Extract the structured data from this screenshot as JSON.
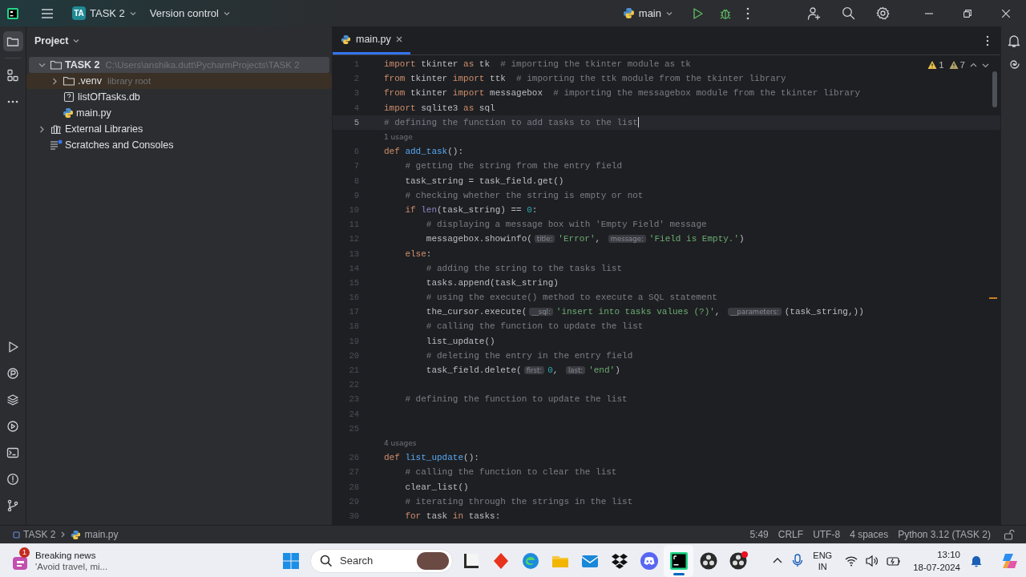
{
  "title_bar": {
    "project_badge": "TA",
    "project": "TASK 2",
    "vcs": "Version control",
    "run_config": "main"
  },
  "project_panel": {
    "title": "Project",
    "tree": [
      {
        "label": "TASK 2",
        "kind": "folder",
        "path": "C:\\Users\\anshika.dutt\\PycharmProjects\\TASK 2",
        "expanded": true,
        "selected": true,
        "library_root": false,
        "children": [
          {
            "label": ".venv",
            "kind": "folder",
            "hint": "library root",
            "expanded": false,
            "selected": false,
            "library_root": true
          },
          {
            "label": "listOfTasks.db",
            "kind": "unknown-file",
            "selected": false,
            "library_root": false
          },
          {
            "label": "main.py",
            "kind": "python",
            "selected": false,
            "library_root": false
          }
        ]
      },
      {
        "label": "External Libraries",
        "kind": "libraries",
        "expanded": false,
        "selected": false,
        "library_root": false
      },
      {
        "label": "Scratches and Consoles",
        "kind": "scratches",
        "selected": false,
        "library_root": false
      }
    ]
  },
  "editor": {
    "tab": {
      "label": "main.py",
      "selected": true
    },
    "inspections": [
      {
        "kind": "error",
        "count": "1"
      },
      {
        "kind": "warning",
        "count": "7"
      }
    ],
    "lines": [
      {
        "kind": "code",
        "number": "1",
        "current": false,
        "tokens": [
          {
            "kind": "kw",
            "text": "import"
          },
          {
            "kind": "pl",
            "text": " tkinter "
          },
          {
            "kind": "kw",
            "text": "as"
          },
          {
            "kind": "pl",
            "text": " tk  "
          },
          {
            "kind": "cm",
            "text": "# importing the tkinter module as tk"
          }
        ]
      },
      {
        "kind": "code",
        "number": "2",
        "current": false,
        "tokens": [
          {
            "kind": "kw",
            "text": "from"
          },
          {
            "kind": "pl",
            "text": " tkinter "
          },
          {
            "kind": "kw",
            "text": "import"
          },
          {
            "kind": "pl",
            "text": " ttk  "
          },
          {
            "kind": "cm",
            "text": "# importing the ttk module from the tkinter library"
          }
        ]
      },
      {
        "kind": "code",
        "number": "3",
        "current": false,
        "tokens": [
          {
            "kind": "kw",
            "text": "from"
          },
          {
            "kind": "pl",
            "text": " tkinter "
          },
          {
            "kind": "kw",
            "text": "import"
          },
          {
            "kind": "pl",
            "text": " messagebox  "
          },
          {
            "kind": "cm",
            "text": "# importing the messagebox module from the tkinter library"
          }
        ]
      },
      {
        "kind": "code",
        "number": "4",
        "current": false,
        "tokens": [
          {
            "kind": "kw",
            "text": "import"
          },
          {
            "kind": "pl",
            "text": " sqlite3 "
          },
          {
            "kind": "kw",
            "text": "as"
          },
          {
            "kind": "pl",
            "text": " sql"
          }
        ]
      },
      {
        "kind": "code",
        "number": "5",
        "current": true,
        "tokens": [
          {
            "kind": "cm",
            "text": "# defining the function to add tasks to the list"
          }
        ]
      },
      {
        "kind": "usage",
        "text": "1 usage",
        "current": false
      },
      {
        "kind": "code",
        "number": "6",
        "current": false,
        "tokens": [
          {
            "kind": "kw",
            "text": "def"
          },
          {
            "kind": "fn",
            "text": " add_task"
          },
          {
            "kind": "pl",
            "text": "():"
          }
        ]
      },
      {
        "kind": "code",
        "number": "7",
        "current": false,
        "tokens": [
          {
            "kind": "cm",
            "text": "    # getting the string from the entry field"
          }
        ]
      },
      {
        "kind": "code",
        "number": "8",
        "current": false,
        "tokens": [
          {
            "kind": "pl",
            "text": "    task_string = task_field.get()"
          }
        ]
      },
      {
        "kind": "code",
        "number": "9",
        "current": false,
        "tokens": [
          {
            "kind": "cm",
            "text": "    # checking whether the string is empty or not"
          }
        ]
      },
      {
        "kind": "code",
        "number": "10",
        "current": false,
        "tokens": [
          {
            "kind": "kw",
            "text": "    if"
          },
          {
            "kind": "bi",
            "text": " len"
          },
          {
            "kind": "pl",
            "text": "(task_string) == "
          },
          {
            "kind": "num",
            "text": "0"
          },
          {
            "kind": "pl",
            "text": ":"
          }
        ]
      },
      {
        "kind": "code",
        "number": "11",
        "current": false,
        "tokens": [
          {
            "kind": "cm",
            "text": "        # displaying a message box with 'Empty Field' message"
          }
        ]
      },
      {
        "kind": "code",
        "number": "12",
        "current": false,
        "tokens": [
          {
            "kind": "pl",
            "text": "        messagebox.showinfo("
          },
          {
            "kind": "hint",
            "text": "title:"
          },
          {
            "kind": "str",
            "text": "'Error'"
          },
          {
            "kind": "pl",
            "text": ", "
          },
          {
            "kind": "hint",
            "text": "message:"
          },
          {
            "kind": "str",
            "text": "'Field is Empty.'"
          },
          {
            "kind": "pl",
            "text": ")"
          }
        ]
      },
      {
        "kind": "code",
        "number": "13",
        "current": false,
        "tokens": [
          {
            "kind": "kw",
            "text": "    else"
          },
          {
            "kind": "pl",
            "text": ":"
          }
        ]
      },
      {
        "kind": "code",
        "number": "14",
        "current": false,
        "tokens": [
          {
            "kind": "cm",
            "text": "        # adding the string to the tasks list"
          }
        ]
      },
      {
        "kind": "code",
        "number": "15",
        "current": false,
        "tokens": [
          {
            "kind": "pl",
            "text": "        tasks.append(task_string)"
          }
        ]
      },
      {
        "kind": "code",
        "number": "16",
        "current": false,
        "tokens": [
          {
            "kind": "cm",
            "text": "        # using the execute() method to execute a SQL statement"
          }
        ]
      },
      {
        "kind": "code",
        "number": "17",
        "current": false,
        "tokens": [
          {
            "kind": "pl",
            "text": "        the_cursor.execute("
          },
          {
            "kind": "hint",
            "text": "__sql:"
          },
          {
            "kind": "str",
            "text": "'insert into tasks values (?)'"
          },
          {
            "kind": "pl",
            "text": ", "
          },
          {
            "kind": "hint",
            "text": "__parameters:"
          },
          {
            "kind": "pl",
            "text": "(task_string,))"
          }
        ]
      },
      {
        "kind": "code",
        "number": "18",
        "current": false,
        "tokens": [
          {
            "kind": "cm",
            "text": "        # calling the function to update the list"
          }
        ]
      },
      {
        "kind": "code",
        "number": "19",
        "current": false,
        "tokens": [
          {
            "kind": "pl",
            "text": "        list_update()"
          }
        ]
      },
      {
        "kind": "code",
        "number": "20",
        "current": false,
        "tokens": [
          {
            "kind": "cm",
            "text": "        # deleting the entry in the entry field"
          }
        ]
      },
      {
        "kind": "code",
        "number": "21",
        "current": false,
        "tokens": [
          {
            "kind": "pl",
            "text": "        task_field.delete("
          },
          {
            "kind": "hint",
            "text": "first:"
          },
          {
            "kind": "num",
            "text": "0"
          },
          {
            "kind": "pl",
            "text": ", "
          },
          {
            "kind": "hint",
            "text": "last:"
          },
          {
            "kind": "str",
            "text": "'end'"
          },
          {
            "kind": "pl",
            "text": ")"
          }
        ]
      },
      {
        "kind": "code",
        "number": "22",
        "current": false
      },
      {
        "kind": "code",
        "number": "23",
        "current": false,
        "tokens": [
          {
            "kind": "cm",
            "text": "    # defining the function to update the list"
          }
        ]
      },
      {
        "kind": "code",
        "number": "24",
        "current": false
      },
      {
        "kind": "code",
        "number": "25",
        "current": false
      },
      {
        "kind": "usage",
        "text": "4 usages",
        "current": false
      },
      {
        "kind": "code",
        "number": "26",
        "current": false,
        "tokens": [
          {
            "kind": "kw",
            "text": "def"
          },
          {
            "kind": "fn",
            "text": " list_update"
          },
          {
            "kind": "pl",
            "text": "():"
          }
        ]
      },
      {
        "kind": "code",
        "number": "27",
        "current": false,
        "tokens": [
          {
            "kind": "cm",
            "text": "    # calling the function to clear the list"
          }
        ]
      },
      {
        "kind": "code",
        "number": "28",
        "current": false,
        "tokens": [
          {
            "kind": "pl",
            "text": "    clear_list()"
          }
        ]
      },
      {
        "kind": "code",
        "number": "29",
        "current": false,
        "tokens": [
          {
            "kind": "cm",
            "text": "    # iterating through the strings in the list"
          }
        ]
      },
      {
        "kind": "code",
        "number": "30",
        "current": false,
        "tokens": [
          {
            "kind": "kw",
            "text": "    for"
          },
          {
            "kind": "pl",
            "text": " task "
          },
          {
            "kind": "kw",
            "text": "in"
          },
          {
            "kind": "pl",
            "text": " tasks:"
          }
        ]
      }
    ]
  },
  "status_bar": {
    "breadcrumbs": [
      {
        "kind": "project",
        "label": "TASK 2"
      },
      {
        "kind": "python",
        "label": "main.py"
      }
    ],
    "items": [
      "5:49",
      "CRLF",
      "UTF-8",
      "4 spaces",
      "Python 3.12 (TASK 2)"
    ],
    "read_only": false
  },
  "taskbar": {
    "news": {
      "badge": "1",
      "title": "Breaking news",
      "subtitle": "'Avoid travel, mi..."
    },
    "search": {
      "placeholder": "Search"
    },
    "apps": [
      {
        "kind": "tiles",
        "selected": false
      },
      {
        "kind": "diamond",
        "selected": false
      },
      {
        "kind": "edge",
        "selected": false
      },
      {
        "kind": "folder",
        "selected": false
      },
      {
        "kind": "mail",
        "selected": false
      },
      {
        "kind": "dropbox",
        "selected": false
      },
      {
        "kind": "discord",
        "selected": false
      },
      {
        "kind": "pycharm",
        "selected": true
      },
      {
        "kind": "obs",
        "selected": false
      },
      {
        "kind": "obs-notified",
        "selected": false
      }
    ],
    "language": "ENG",
    "region": "IN",
    "time": "13:10",
    "date": "18-07-2024"
  }
}
